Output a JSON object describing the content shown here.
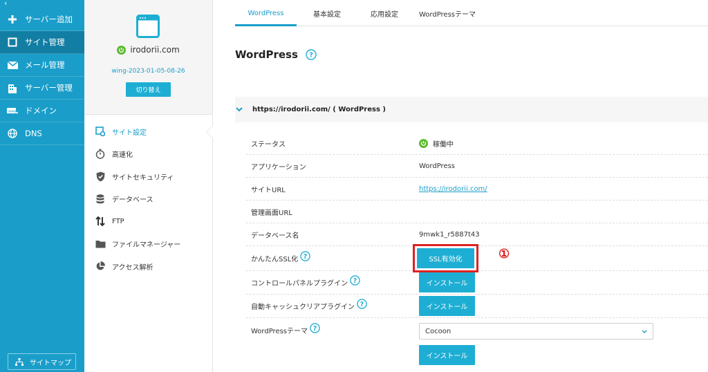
{
  "leftnav": {
    "collapse_icon": "chevron-left-icon",
    "items": [
      {
        "label": "サーバー追加",
        "icon": "plus-icon"
      },
      {
        "label": "サイト管理",
        "icon": "window-icon"
      },
      {
        "label": "メール管理",
        "icon": "mail-icon"
      },
      {
        "label": "サーバー管理",
        "icon": "building-icon"
      },
      {
        "label": "ドメイン",
        "icon": "domain-tag-icon"
      },
      {
        "label": "DNS",
        "icon": "globe-icon"
      }
    ],
    "sitemap_label": "サイトマップ"
  },
  "subnav": {
    "domain": "irodorii.com",
    "server_id": "wing-2023-01-05-08-26",
    "switch_label": "切り替え",
    "items": [
      {
        "label": "サイト設定",
        "icon": "site-settings-icon"
      },
      {
        "label": "高速化",
        "icon": "stopwatch-icon"
      },
      {
        "label": "サイトセキュリティ",
        "icon": "shield-check-icon"
      },
      {
        "label": "データベース",
        "icon": "database-icon"
      },
      {
        "label": "FTP",
        "icon": "updown-arrows-icon"
      },
      {
        "label": "ファイルマネージャー",
        "icon": "folder-icon"
      },
      {
        "label": "アクセス解析",
        "icon": "pie-chart-icon"
      }
    ]
  },
  "tabs": [
    "WordPress",
    "基本設定",
    "応用設定",
    "WordPressテーマ"
  ],
  "page_title": "WordPress",
  "section_title": "https://irodorii.com/ ( WordPress )",
  "rows": {
    "status_label": "ステータス",
    "status_value": "稼働中",
    "app_label": "アプリケーション",
    "app_value": "WordPress",
    "url_label": "サイトURL",
    "url_value": "https://irodorii.com/",
    "admin_url_label": "管理画面URL",
    "db_label": "データベース名",
    "db_value": "9mwk1_r5887t43",
    "ssl_label": "かんたんSSL化",
    "ssl_button": "SSL有効化",
    "cp_plugin_label": "コントロールパネルプラグイン",
    "cp_plugin_button": "インストール",
    "cache_plugin_label": "自動キャッシュクリアプラグイン",
    "cache_plugin_button": "インストール",
    "theme_label": "WordPressテーマ",
    "theme_value": "Cocoon",
    "theme_button": "インストール"
  },
  "annotation": "①",
  "colors": {
    "brand": "#1a9ec9",
    "nav_active": "#137ea3",
    "button": "#1eaed4",
    "status_ok": "#5cb82e",
    "annotation": "#e02020"
  }
}
